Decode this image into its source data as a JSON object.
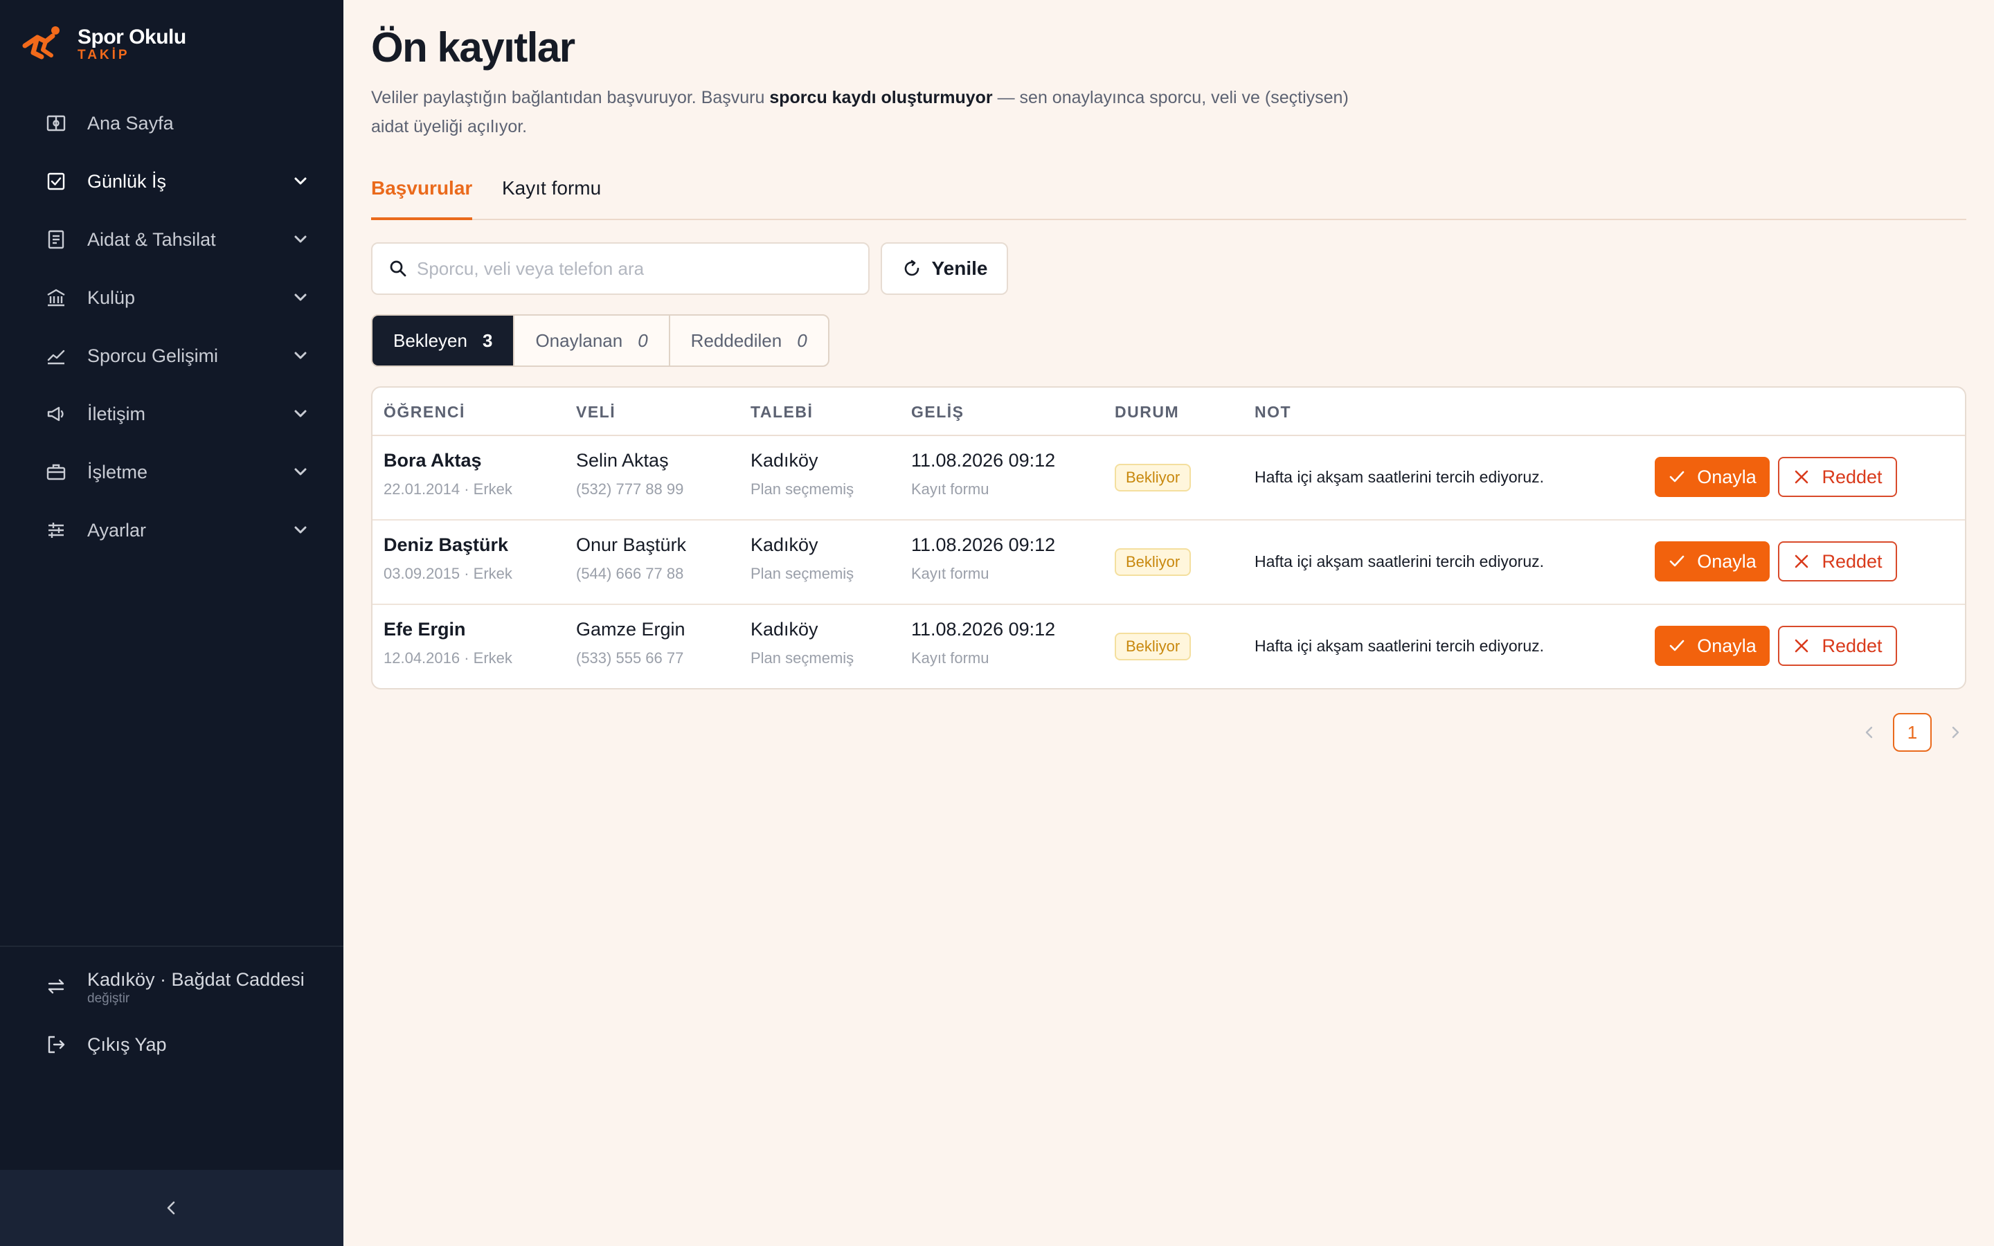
{
  "brand": {
    "name": "Spor Okulu",
    "sub": "TAKİP",
    "accent": "#f26a1b"
  },
  "sidebar": {
    "items": [
      {
        "label": "Ana Sayfa",
        "icon": "dashboard-icon"
      },
      {
        "label": "Günlük İş",
        "icon": "checkbox-icon"
      },
      {
        "label": "Aidat & Tahsilat",
        "icon": "receipt-icon"
      },
      {
        "label": "Kulüp",
        "icon": "building-icon"
      },
      {
        "label": "Sporcu Gelişimi",
        "icon": "chart-line-icon"
      },
      {
        "label": "İletişim",
        "icon": "megaphone-icon"
      },
      {
        "label": "İşletme",
        "icon": "briefcase-icon"
      },
      {
        "label": "Ayarlar",
        "icon": "sliders-icon"
      }
    ],
    "active": "Günlük İş",
    "branch": {
      "name": "Kadıköy · Bağdat Caddesi",
      "action": "değiştir"
    },
    "logout": "Çıkış Yap"
  },
  "page": {
    "title": "Ön kayıtlar",
    "desc_before": "Veliler paylaştığın bağlantıdan başvuruyor. Başvuru ",
    "desc_bold": "sporcu kaydı oluşturmuyor",
    "desc_after": " — sen onaylayınca sporcu, veli ve (seçtiysen) aidat üyeliği açılıyor."
  },
  "tabs": [
    {
      "label": "Başvurular",
      "active": true
    },
    {
      "label": "Kayıt formu",
      "active": false
    }
  ],
  "search": {
    "placeholder": "Sporcu, veli veya telefon ara",
    "value": ""
  },
  "refresh_label": "Yenile",
  "filters": [
    {
      "label": "Bekleyen",
      "count": "3",
      "active": true
    },
    {
      "label": "Onaylanan",
      "count": "0",
      "active": false
    },
    {
      "label": "Reddedilen",
      "count": "0",
      "active": false
    }
  ],
  "table": {
    "headers": [
      "ÖĞRENCİ",
      "VELİ",
      "TALEBİ",
      "GELİŞ",
      "DURUM",
      "NOT"
    ],
    "rows": [
      {
        "student": "Bora Aktaş",
        "student_sub": "22.01.2014 · Erkek",
        "parent": "Selin Aktaş",
        "phone": "(532) 777 88 99",
        "branch": "Kadıköy",
        "plan": "Plan seçmemiş",
        "date": "11.08.2026 09:12",
        "source": "Kayıt formu",
        "status": "Bekliyor",
        "note": "Hafta içi akşam saatlerini tercih ediyoruz."
      },
      {
        "student": "Deniz Baştürk",
        "student_sub": "03.09.2015 · Erkek",
        "parent": "Onur Baştürk",
        "phone": "(544) 666 77 88",
        "branch": "Kadıköy",
        "plan": "Plan seçmemiş",
        "date": "11.08.2026 09:12",
        "source": "Kayıt formu",
        "status": "Bekliyor",
        "note": "Hafta içi akşam saatlerini tercih ediyoruz."
      },
      {
        "student": "Efe Ergin",
        "student_sub": "12.04.2016 · Erkek",
        "parent": "Gamze Ergin",
        "phone": "(533) 555 66 77",
        "branch": "Kadıköy",
        "plan": "Plan seçmemiş",
        "date": "11.08.2026 09:12",
        "source": "Kayıt formu",
        "status": "Bekliyor",
        "note": "Hafta içi akşam saatlerini tercih ediyoruz."
      }
    ],
    "approve_label": "Onayla",
    "reject_label": "Reddet"
  },
  "pagination": {
    "current": "1"
  },
  "colors": {
    "sidebar_bg": "#111827",
    "page_bg": "#fcf4ee",
    "accent": "#ea6a1c",
    "approve": "#f2620d",
    "reject": "#d93a1b",
    "status_pending": "#c8880e"
  }
}
